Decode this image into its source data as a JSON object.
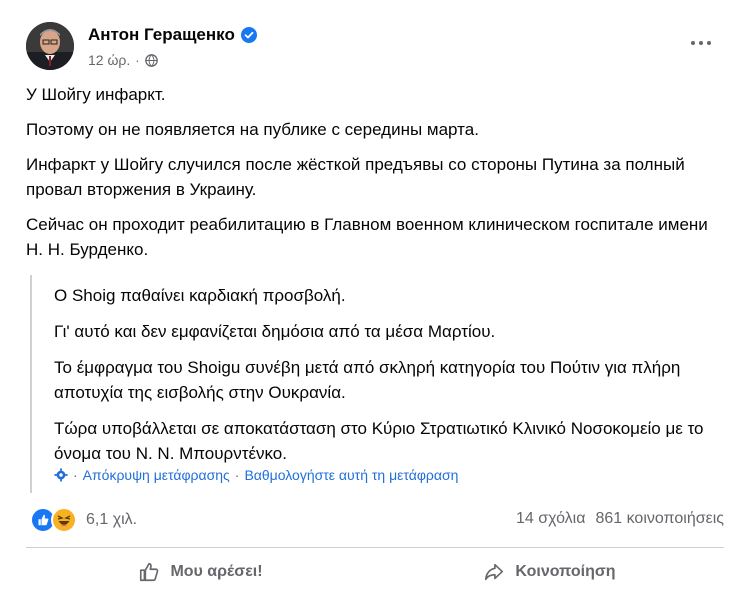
{
  "post": {
    "author": "Антон Геращенко",
    "time": "12 ώρ.",
    "dot": "·",
    "paragraphs": [
      "У Шойгу инфаркт.",
      "Поэтому он не появляется на публике с середины марта.",
      "Инфаркт у Шойгу случился после жёсткой предъявы  со стороны Путина за полный провал вторжения в Украину.",
      "Сейчас он проходит реабилитацию в Главном  военном клиническом госпитале  имени Н. Н. Бурденко."
    ],
    "translation": {
      "paragraphs": [
        "Ο Shoig παθαίνει καρδιακή προσβολή.",
        "Γι' αυτό και δεν εμφανίζεται δημόσια από τα μέσα Μαρτίου.",
        "Το έμφραγμα του Shoigu συνέβη μετά από σκληρή κατηγορία του Πούτιν για πλήρη αποτυχία της εισβολής στην Ουκρανία.",
        "Τώρα υποβάλλεται σε αποκατάσταση στο Κύριο Στρατιωτικό Κλινικό Νοσοκομείο με το όνομα του Ν. Ν. Μπουρντένκο."
      ],
      "hide_link": "Απόκρυψη μετάφρασης",
      "separator": "·",
      "rate_link": "Βαθμολογήστε αυτή τη μετάφραση"
    },
    "reactions_count": "6,1 χιλ.",
    "comments": "14 σχόλια",
    "shares": "861 κοινοποιήσεις",
    "actions": {
      "like": "Μου αρέσει!",
      "share": "Κοινοποίηση"
    },
    "icons": [
      "verified-badge-icon",
      "globe-icon",
      "more-icon",
      "gear-icon",
      "like-reaction-icon",
      "haha-reaction-icon",
      "thumbs-up-icon",
      "share-arrow-icon"
    ],
    "colors": {
      "link": "#216fdb",
      "secondary_text": "#65676b",
      "like_blue": "#1877f2",
      "haha_yellow": "#f7b125"
    }
  }
}
